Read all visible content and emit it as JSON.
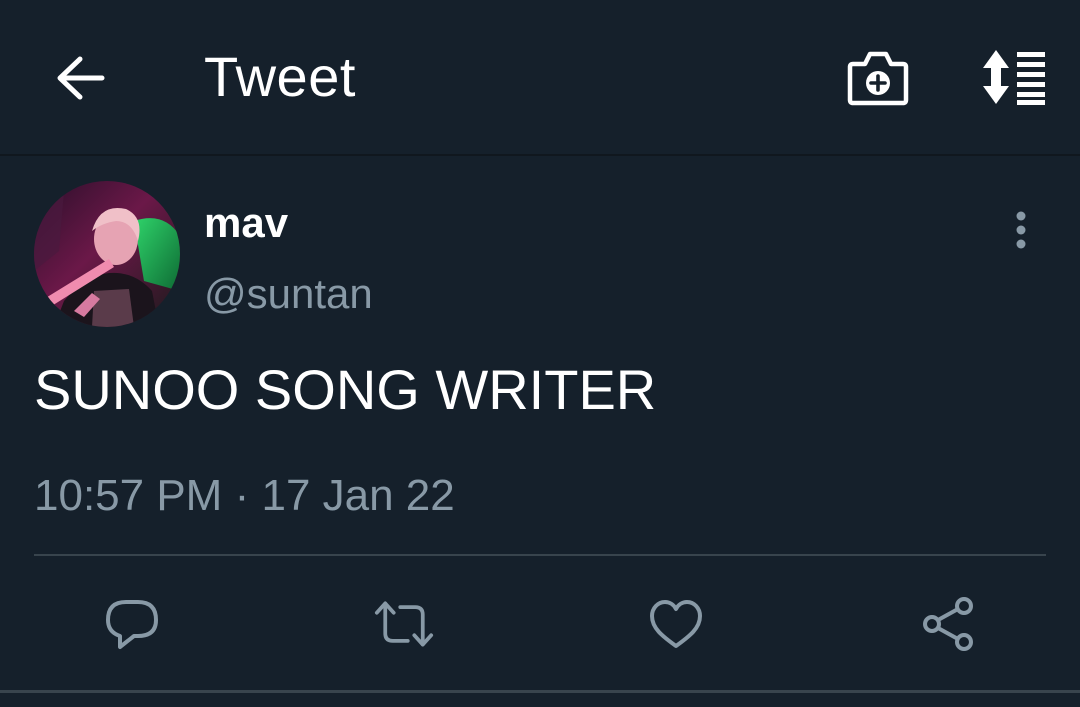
{
  "header": {
    "title": "Tweet",
    "icons": [
      "back-arrow-icon",
      "camera-plus-icon",
      "sort-thread-icon"
    ]
  },
  "tweet": {
    "display_name": "mav",
    "handle": "@suntan",
    "text": "SUNOO SONG WRITER",
    "time": "10:57 PM",
    "separator": "·",
    "date": "17 Jan 22"
  },
  "actions": [
    "reply-icon",
    "retweet-icon",
    "like-icon",
    "share-icon"
  ],
  "colors": {
    "background": "#15202b",
    "primary_text": "#ffffff",
    "secondary_text": "#8899a6",
    "divider": "#38444d",
    "icon": "#8899a6"
  }
}
